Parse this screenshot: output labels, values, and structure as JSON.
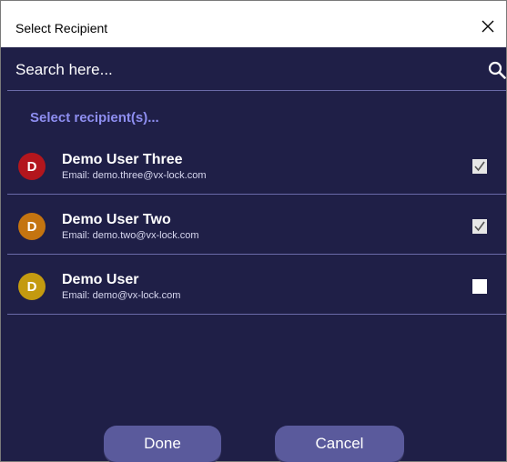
{
  "dialog": {
    "title": "Select Recipient",
    "close_icon": "close-icon"
  },
  "search": {
    "placeholder": "Search here...",
    "value": "",
    "icon": "search-icon"
  },
  "hint": "Select recipient(s)...",
  "recipients": [
    {
      "initial": "D",
      "name": "Demo User Three",
      "email": "Email: demo.three@vx-lock.com",
      "avatar_color": "#b3161d",
      "checked": true
    },
    {
      "initial": "D",
      "name": "Demo User Two",
      "email": "Email: demo.two@vx-lock.com",
      "avatar_color": "#c47410",
      "checked": true
    },
    {
      "initial": "D",
      "name": "Demo User",
      "email": "Email: demo@vx-lock.com",
      "avatar_color": "#c49a10",
      "checked": false
    }
  ],
  "actions": {
    "done_label": "Done",
    "cancel_label": "Cancel"
  },
  "colors": {
    "background": "#1f1f47",
    "accent_text": "#8e8ef0",
    "button": "#5a5a9c",
    "divider": "#6a6aa8"
  }
}
